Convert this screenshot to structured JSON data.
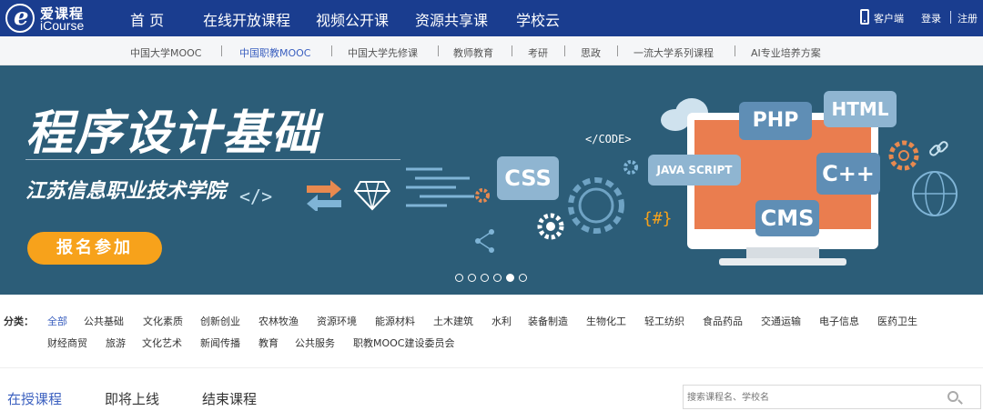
{
  "logo": {
    "cn": "爱课程",
    "en": "iCourse",
    "glyph": "e"
  },
  "topnav": {
    "items": [
      "首 页",
      "在线开放课程",
      "视频公开课",
      "资源共享课",
      "学校云"
    ],
    "client": "客户端",
    "login": "登录",
    "register": "注册"
  },
  "subnav": {
    "items": [
      "中国大学MOOC",
      "中国职教MOOC",
      "中国大学先修课",
      "教师教育",
      "考研",
      "思政",
      "一流大学系列课程",
      "AI专业培养方案"
    ],
    "active_index": 1
  },
  "banner": {
    "title": "程序设计基础",
    "school": "江苏信息职业技术学院",
    "button": "报名参加",
    "code_tag": "</>",
    "code_label": "</CODE>",
    "bubbles": [
      "HTML",
      "PHP",
      "JAVA SCRIPT",
      "C++",
      "CSS",
      "CMS"
    ],
    "hash": "{#}",
    "slide_count": 6,
    "active_slide": 5,
    "colors": {
      "background": "#2c5d78",
      "button": "#f7a21b",
      "screen": "#ea7d4f"
    }
  },
  "categories": {
    "label": "分类：",
    "items": [
      "全部",
      "公共基础",
      "文化素质",
      "创新创业",
      "农林牧渔",
      "资源环境",
      "能源材料",
      "土木建筑",
      "水利",
      "装备制造",
      "生物化工",
      "轻工纺织",
      "食品药品",
      "交通运输",
      "电子信息",
      "医药卫生",
      "财经商贸",
      "旅游",
      "文化艺术",
      "新闻传播",
      "教育",
      "公共服务",
      "职教MOOC建设委员会"
    ],
    "active_index": 0
  },
  "tabs": {
    "items": [
      "在授课程",
      "即将上线",
      "结束课程"
    ],
    "active_index": 0
  },
  "search": {
    "placeholder": "搜索课程名、学校名"
  },
  "icons": [
    "logo-icon",
    "phone-icon",
    "search-icon",
    "cloud-icon",
    "gear-icon",
    "diamond-icon",
    "arrows-icon",
    "share-icon",
    "link-icon",
    "globe-icon"
  ]
}
